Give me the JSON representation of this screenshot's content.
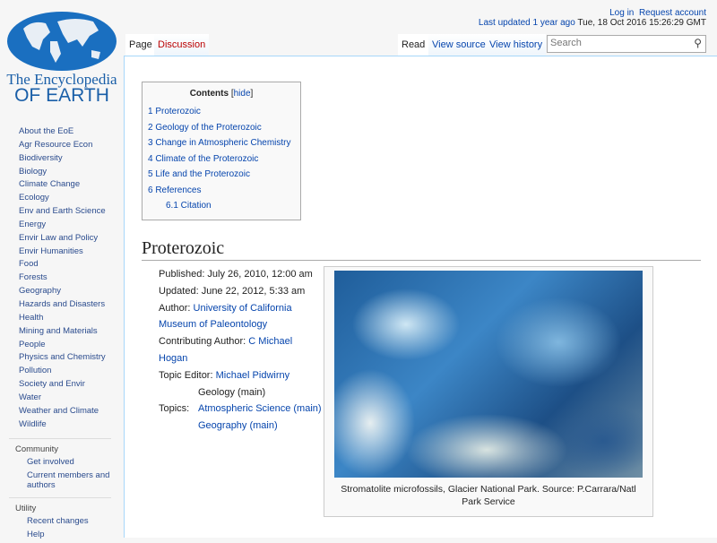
{
  "logo": {
    "line1": "The Encyclopedia",
    "line2": "OF EARTH"
  },
  "personal": {
    "login": "Log in",
    "request": "Request account",
    "last_updated_link": "Last updated 1 year ago",
    "last_updated_date": "Tue, 18 Oct 2016 15:26:29 GMT"
  },
  "tabs": {
    "page": "Page",
    "discussion": "Discussion",
    "read": "Read",
    "view_source": "View source",
    "view_history": "View history"
  },
  "search": {
    "placeholder": "Search"
  },
  "sidebar": {
    "items": [
      "About the EoE",
      "Agr Resource Econ",
      "Biodiversity",
      "Biology",
      "Climate Change",
      "Ecology",
      "Env and Earth Science",
      "Energy",
      "Envir Law and Policy",
      "Envir Humanities",
      "Food",
      "Forests",
      "Geography",
      "Hazards and Disasters",
      "Health",
      "Mining and Materials",
      "People",
      "Physics and Chemistry",
      "Pollution",
      "Society and Envir",
      "Water",
      "Weather and Climate",
      "Wildlife"
    ],
    "community": {
      "title": "Community",
      "items": [
        "Get involved",
        "Current members and authors"
      ]
    },
    "utility": {
      "title": "Utility",
      "items": [
        "Recent changes",
        "Help"
      ]
    }
  },
  "toc": {
    "title": "Contents",
    "hide": "hide",
    "items": [
      "1 Proterozoic",
      "2 Geology of the Proterozoic",
      "3 Change in Atmospheric Chemistry",
      "4 Climate of the Proterozoic",
      "5 Life and the Proterozoic",
      "6 References",
      "6.1 Citation"
    ]
  },
  "article": {
    "title": "Proterozoic",
    "published": "Published: July 26, 2010, 12:00 am",
    "updated": "Updated: June 22, 2012, 5:33 am",
    "author_label": "Author:",
    "author": "University of California Museum of Paleontology",
    "contrib_label": "Contributing Author:",
    "contrib": "C Michael Hogan",
    "editor_label": "Topic Editor:",
    "editor": "Michael Pidwirny",
    "topics_label": "Topics:",
    "topics": [
      "Geology (main)",
      "Atmospheric Science (main)",
      "Geography (main)"
    ],
    "caption": "Stromatolite microfossils, Glacier National Park. Source: P.Carrara/Natl Park Service"
  }
}
